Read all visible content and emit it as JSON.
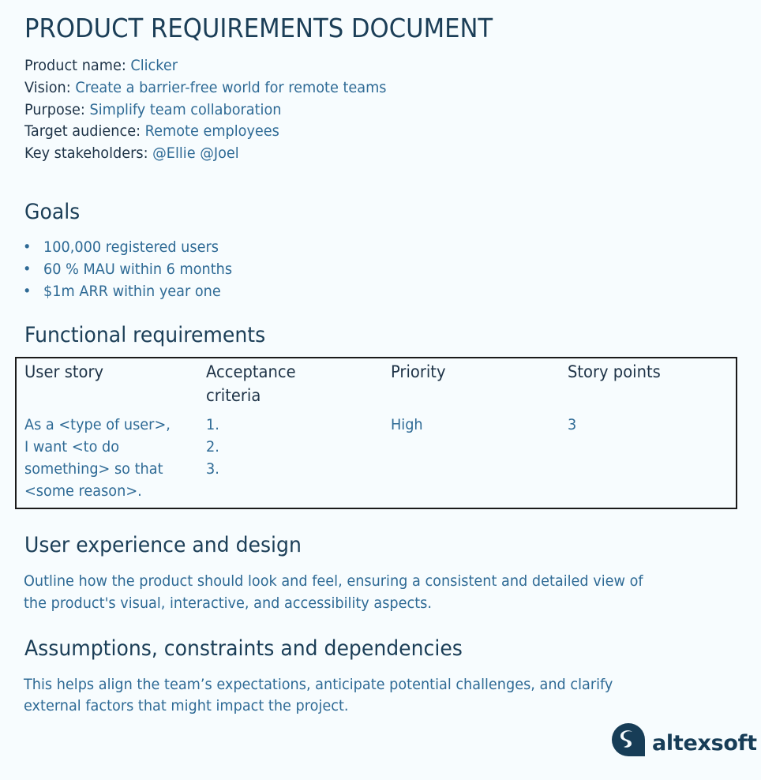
{
  "document": {
    "title": "PRODUCT REQUIREMENTS DOCUMENT",
    "meta": [
      {
        "label": "Product name: ",
        "value": "Clicker"
      },
      {
        "label": "Vision: ",
        "value": "Create a barrier-free world for remote teams"
      },
      {
        "label": "Purpose: ",
        "value": "Simplify team collaboration"
      },
      {
        "label": "Target audience: ",
        "value": "Remote employees"
      },
      {
        "label": "Key stakeholders: ",
        "value": "@Ellie @Joel"
      }
    ],
    "goals": {
      "heading": "Goals",
      "bullet": "•",
      "items": [
        "100,000 registered users",
        "60 % MAU within 6 months",
        "$1m ARR within year one"
      ]
    },
    "functional_requirements": {
      "heading": "Functional requirements",
      "columns": [
        "User story",
        "Acceptance",
        "criteria",
        "Priority",
        "Story points"
      ],
      "rows": [
        {
          "user_story": [
            "As a <type of user>,",
            "I want <to do",
            "something> so that",
            "<some reason>."
          ],
          "acceptance_criteria": [
            "1.",
            "2.",
            "3."
          ],
          "priority": "High",
          "story_points": "3"
        }
      ]
    },
    "ux": {
      "heading": "User experience and design",
      "text": [
        "Outline how the product should look and feel, ensuring a consistent and detailed view of",
        "the product's visual, interactive, and accessibility aspects."
      ]
    },
    "assumptions": {
      "heading": "Assumptions, constraints and dependencies",
      "text": [
        "This helps align the team’s expectations, anticipate potential challenges, and clarify",
        "external factors that might impact the project."
      ]
    },
    "logo": {
      "text": "altexsoft",
      "icon": "altexsoft-logo-icon"
    }
  },
  "colors": {
    "background": "#f7fcfe",
    "heading": "#1b3e57",
    "label": "#1e3347",
    "value": "#2e6a95",
    "logo": "#173d57",
    "table_border": "#1a1a1a"
  }
}
